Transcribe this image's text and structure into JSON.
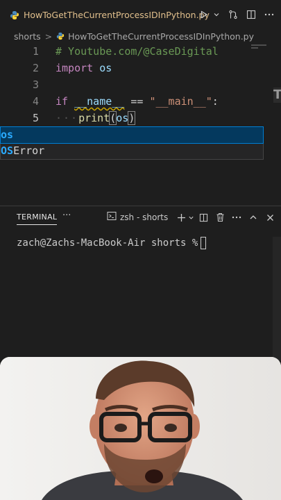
{
  "tab": {
    "filename": "HowToGetTheCurrentProcessIDInPython.py"
  },
  "breadcrumb": {
    "folder": "shorts",
    "separator": ">",
    "file": "HowToGetTheCurrentProcessIDInPython.py"
  },
  "editor": {
    "lines": [
      {
        "number": "1",
        "text": "# Youtube.com/@CaseDigital"
      },
      {
        "number": "2",
        "kw": "import",
        "rest": " os"
      },
      {
        "number": "3"
      },
      {
        "number": "4",
        "kw": "if",
        "name": "__name__",
        "op": " == ",
        "str": "\"__main__\"",
        "colon": ":"
      },
      {
        "number": "5",
        "indent": "···",
        "fn": "print",
        "open": "(",
        "arg": "os",
        "close": ")"
      }
    ],
    "suggestions": [
      {
        "match": "os",
        "rest": ""
      },
      {
        "match": "OS",
        "rest": "Error"
      }
    ],
    "overflow_glyph": "T"
  },
  "panel": {
    "terminal_tab": "TERMINAL",
    "more": "···",
    "shell_label": "zsh - shorts",
    "prompt": "zach@Zachs-MacBook-Air shorts % "
  },
  "icons": {
    "tab_actions": [
      "run-icon",
      "chevron-down-icon",
      "source-control-icon",
      "split-editor-icon",
      "more-icon"
    ],
    "panel_actions": [
      "add-terminal-icon",
      "chevron-down-icon",
      "split-terminal-icon",
      "trash-icon",
      "more-icon",
      "chevron-up-icon",
      "close-icon"
    ]
  },
  "colors": {
    "editor_bg": "#1e1e1e",
    "tab_title": "#e2c08d",
    "comment": "#6a9955",
    "keyword": "#c586c0",
    "string": "#ce9178",
    "suggest_selected": "#04395e",
    "suggest_match": "#2aaaff"
  }
}
